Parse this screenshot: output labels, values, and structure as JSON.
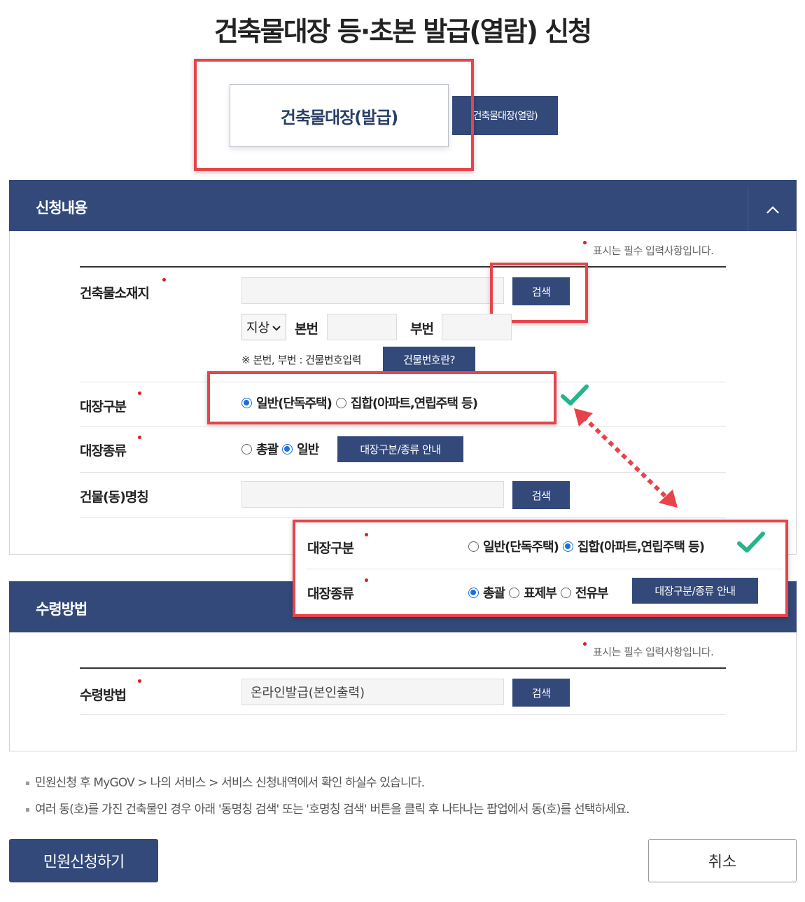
{
  "page_title": "건축물대장 등·초본 발급(열람) 신청",
  "tabs": {
    "issue": "건축물대장(발급)",
    "view": "건축물대장(열람)"
  },
  "section1": {
    "title": "신청내용",
    "required_note": "표시는 필수 입력사항입니다.",
    "building_location": {
      "label": "건축물소재지",
      "search_button": "검색",
      "select_value": "지상",
      "main_no_label": "본번",
      "sub_no_label": "부번",
      "hint": "※ 본번, 부번 : 건물번호입력",
      "help_button": "건물번호란?"
    },
    "ledger_type": {
      "label": "대장구분",
      "options": [
        "일반(단독주택)",
        "집합(아파트,연립주택 등)"
      ],
      "selected": "일반(단독주택)"
    },
    "ledger_kind": {
      "label": "대장종류",
      "options": [
        "총괄",
        "일반"
      ],
      "selected": "일반",
      "guide_button": "대장구분/종류 안내"
    },
    "building_name": {
      "label": "건물(동)명칭",
      "search_button": "검색"
    }
  },
  "popup": {
    "ledger_type": {
      "label": "대장구분",
      "options": [
        "일반(단독주택)",
        "집합(아파트,연립주택 등)"
      ],
      "selected": "집합(아파트,연립주택 등)"
    },
    "ledger_kind": {
      "label": "대장종류",
      "options": [
        "총괄",
        "표제부",
        "전유부"
      ],
      "selected": "총괄",
      "guide_button": "대장구분/종류 안내"
    }
  },
  "section2": {
    "title": "수령방법",
    "required_note": "표시는 필수 입력사항입니다.",
    "receive_method": {
      "label": "수령방법",
      "value": "온라인발급(본인출력)",
      "search_button": "검색"
    }
  },
  "notes": [
    "민원신청 후 MyGOV > 나의 서비스 > 서비스 신청내역에서 확인 하실수 있습니다.",
    "여러 동(호)를 가진 건축물인 경우 아래 '동명칭 검색' 또는 '호명칭 검색' 버튼을 클릭 후 나타나는 팝업에서 동(호)를 선택하세요."
  ],
  "actions": {
    "submit": "민원신청하기",
    "cancel": "취소"
  },
  "colors": {
    "primary": "#33497a",
    "highlight": "#e8434a",
    "check": "#25b58a",
    "radio_selected": "#1a6fe0"
  }
}
